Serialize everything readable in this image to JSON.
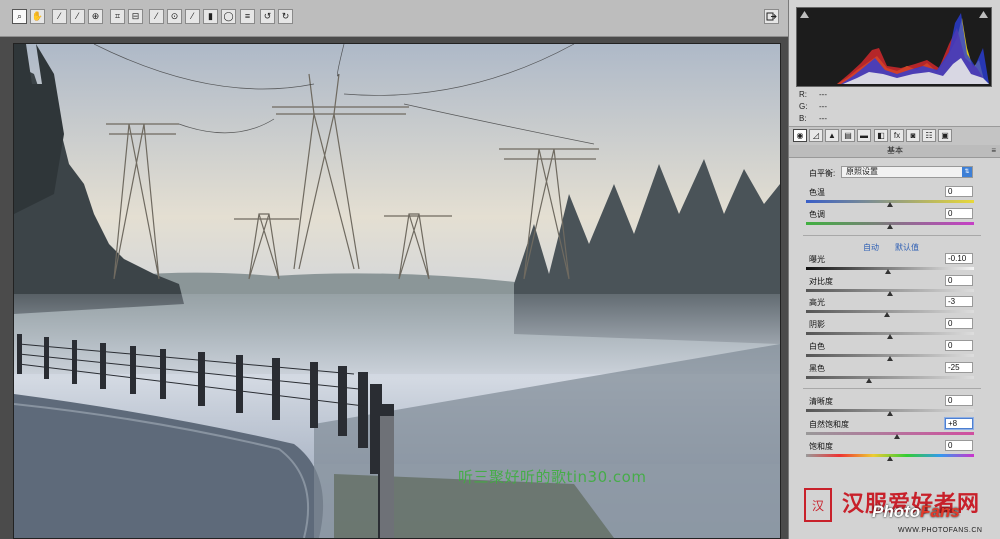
{
  "toolbar": {
    "tools": [
      {
        "icon": "zoom-icon",
        "glyph": "⌕"
      },
      {
        "icon": "hand-icon",
        "glyph": "✋"
      },
      {
        "icon": "white-balance-icon",
        "glyph": "⁄"
      },
      {
        "icon": "color-sampler-icon",
        "glyph": "⁄"
      },
      {
        "icon": "targeted-adjust-icon",
        "glyph": "⊕"
      },
      {
        "icon": "crop-icon",
        "glyph": "⌗"
      },
      {
        "icon": "straighten-icon",
        "glyph": "⊟"
      },
      {
        "icon": "spot-removal-icon",
        "glyph": "⁄"
      },
      {
        "icon": "red-eye-icon",
        "glyph": "⊙"
      },
      {
        "icon": "adjustment-brush-icon",
        "glyph": "⁄"
      },
      {
        "icon": "graduated-filter-icon",
        "glyph": "▮"
      },
      {
        "icon": "radial-filter-icon",
        "glyph": "◯"
      },
      {
        "icon": "preferences-icon",
        "glyph": "≡"
      },
      {
        "icon": "rotate-left-icon",
        "glyph": "↺"
      },
      {
        "icon": "rotate-right-icon",
        "glyph": "↻"
      }
    ],
    "export_icon": "export-icon"
  },
  "readout": {
    "r_label": "R:",
    "r_value": "---",
    "g_label": "G:",
    "g_value": "---",
    "b_label": "B:",
    "b_value": "---"
  },
  "panel": {
    "title": "基本",
    "menu_glyph": "≡",
    "white_balance": {
      "label": "白平衡:",
      "value": "原照设置"
    },
    "auto_label": "自动",
    "default_label": "默认值",
    "sliders": [
      {
        "key": "temp",
        "label": "色温",
        "value": "0",
        "level": 0.5
      },
      {
        "key": "tint",
        "label": "色调",
        "value": "0",
        "level": 0.5
      },
      {
        "key": "exposure",
        "label": "曝光",
        "value": "-0.10",
        "level": 0.49
      },
      {
        "key": "contrast",
        "label": "对比度",
        "value": "0",
        "level": 0.5
      },
      {
        "key": "highlights",
        "label": "高光",
        "value": "-3",
        "level": 0.485
      },
      {
        "key": "shadows",
        "label": "阴影",
        "value": "0",
        "level": 0.5
      },
      {
        "key": "whites",
        "label": "白色",
        "value": "0",
        "level": 0.5
      },
      {
        "key": "blacks",
        "label": "黑色",
        "value": "-25",
        "level": 0.375
      },
      {
        "key": "clarity",
        "label": "清晰度",
        "value": "0",
        "level": 0.5
      },
      {
        "key": "vibrance",
        "label": "自然饱和度",
        "value": "+8",
        "level": 0.54
      },
      {
        "key": "saturation",
        "label": "饱和度",
        "value": "0",
        "level": 0.5
      }
    ]
  },
  "watermark": "听三聚好听的歌tin30.com",
  "logo": {
    "seal": "汉",
    "name": "汉服爱好者网",
    "photo": "Photo",
    "fans": "Fans",
    "url": "WWW.PHOTOFANS.CN"
  },
  "colors": {
    "accent": "#3d7fd6",
    "link": "#2e5fb4",
    "logo_red": "#c8202a"
  }
}
